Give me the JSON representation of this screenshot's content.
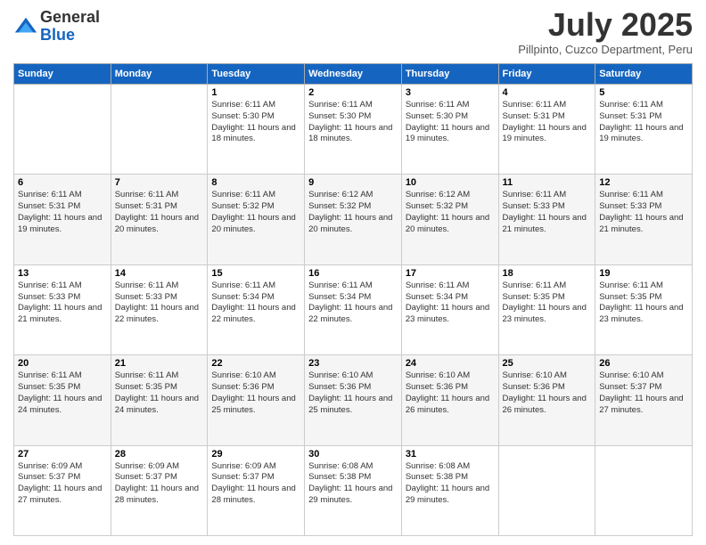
{
  "logo": {
    "general": "General",
    "blue": "Blue"
  },
  "header": {
    "month": "July 2025",
    "location": "Pillpinto, Cuzco Department, Peru"
  },
  "weekdays": [
    "Sunday",
    "Monday",
    "Tuesday",
    "Wednesday",
    "Thursday",
    "Friday",
    "Saturday"
  ],
  "weeks": [
    [
      {
        "day": "",
        "sunrise": "",
        "sunset": "",
        "daylight": ""
      },
      {
        "day": "",
        "sunrise": "",
        "sunset": "",
        "daylight": ""
      },
      {
        "day": "1",
        "sunrise": "Sunrise: 6:11 AM",
        "sunset": "Sunset: 5:30 PM",
        "daylight": "Daylight: 11 hours and 18 minutes."
      },
      {
        "day": "2",
        "sunrise": "Sunrise: 6:11 AM",
        "sunset": "Sunset: 5:30 PM",
        "daylight": "Daylight: 11 hours and 18 minutes."
      },
      {
        "day": "3",
        "sunrise": "Sunrise: 6:11 AM",
        "sunset": "Sunset: 5:30 PM",
        "daylight": "Daylight: 11 hours and 19 minutes."
      },
      {
        "day": "4",
        "sunrise": "Sunrise: 6:11 AM",
        "sunset": "Sunset: 5:31 PM",
        "daylight": "Daylight: 11 hours and 19 minutes."
      },
      {
        "day": "5",
        "sunrise": "Sunrise: 6:11 AM",
        "sunset": "Sunset: 5:31 PM",
        "daylight": "Daylight: 11 hours and 19 minutes."
      }
    ],
    [
      {
        "day": "6",
        "sunrise": "Sunrise: 6:11 AM",
        "sunset": "Sunset: 5:31 PM",
        "daylight": "Daylight: 11 hours and 19 minutes."
      },
      {
        "day": "7",
        "sunrise": "Sunrise: 6:11 AM",
        "sunset": "Sunset: 5:31 PM",
        "daylight": "Daylight: 11 hours and 20 minutes."
      },
      {
        "day": "8",
        "sunrise": "Sunrise: 6:11 AM",
        "sunset": "Sunset: 5:32 PM",
        "daylight": "Daylight: 11 hours and 20 minutes."
      },
      {
        "day": "9",
        "sunrise": "Sunrise: 6:12 AM",
        "sunset": "Sunset: 5:32 PM",
        "daylight": "Daylight: 11 hours and 20 minutes."
      },
      {
        "day": "10",
        "sunrise": "Sunrise: 6:12 AM",
        "sunset": "Sunset: 5:32 PM",
        "daylight": "Daylight: 11 hours and 20 minutes."
      },
      {
        "day": "11",
        "sunrise": "Sunrise: 6:11 AM",
        "sunset": "Sunset: 5:33 PM",
        "daylight": "Daylight: 11 hours and 21 minutes."
      },
      {
        "day": "12",
        "sunrise": "Sunrise: 6:11 AM",
        "sunset": "Sunset: 5:33 PM",
        "daylight": "Daylight: 11 hours and 21 minutes."
      }
    ],
    [
      {
        "day": "13",
        "sunrise": "Sunrise: 6:11 AM",
        "sunset": "Sunset: 5:33 PM",
        "daylight": "Daylight: 11 hours and 21 minutes."
      },
      {
        "day": "14",
        "sunrise": "Sunrise: 6:11 AM",
        "sunset": "Sunset: 5:33 PM",
        "daylight": "Daylight: 11 hours and 22 minutes."
      },
      {
        "day": "15",
        "sunrise": "Sunrise: 6:11 AM",
        "sunset": "Sunset: 5:34 PM",
        "daylight": "Daylight: 11 hours and 22 minutes."
      },
      {
        "day": "16",
        "sunrise": "Sunrise: 6:11 AM",
        "sunset": "Sunset: 5:34 PM",
        "daylight": "Daylight: 11 hours and 22 minutes."
      },
      {
        "day": "17",
        "sunrise": "Sunrise: 6:11 AM",
        "sunset": "Sunset: 5:34 PM",
        "daylight": "Daylight: 11 hours and 23 minutes."
      },
      {
        "day": "18",
        "sunrise": "Sunrise: 6:11 AM",
        "sunset": "Sunset: 5:35 PM",
        "daylight": "Daylight: 11 hours and 23 minutes."
      },
      {
        "day": "19",
        "sunrise": "Sunrise: 6:11 AM",
        "sunset": "Sunset: 5:35 PM",
        "daylight": "Daylight: 11 hours and 23 minutes."
      }
    ],
    [
      {
        "day": "20",
        "sunrise": "Sunrise: 6:11 AM",
        "sunset": "Sunset: 5:35 PM",
        "daylight": "Daylight: 11 hours and 24 minutes."
      },
      {
        "day": "21",
        "sunrise": "Sunrise: 6:11 AM",
        "sunset": "Sunset: 5:35 PM",
        "daylight": "Daylight: 11 hours and 24 minutes."
      },
      {
        "day": "22",
        "sunrise": "Sunrise: 6:10 AM",
        "sunset": "Sunset: 5:36 PM",
        "daylight": "Daylight: 11 hours and 25 minutes."
      },
      {
        "day": "23",
        "sunrise": "Sunrise: 6:10 AM",
        "sunset": "Sunset: 5:36 PM",
        "daylight": "Daylight: 11 hours and 25 minutes."
      },
      {
        "day": "24",
        "sunrise": "Sunrise: 6:10 AM",
        "sunset": "Sunset: 5:36 PM",
        "daylight": "Daylight: 11 hours and 26 minutes."
      },
      {
        "day": "25",
        "sunrise": "Sunrise: 6:10 AM",
        "sunset": "Sunset: 5:36 PM",
        "daylight": "Daylight: 11 hours and 26 minutes."
      },
      {
        "day": "26",
        "sunrise": "Sunrise: 6:10 AM",
        "sunset": "Sunset: 5:37 PM",
        "daylight": "Daylight: 11 hours and 27 minutes."
      }
    ],
    [
      {
        "day": "27",
        "sunrise": "Sunrise: 6:09 AM",
        "sunset": "Sunset: 5:37 PM",
        "daylight": "Daylight: 11 hours and 27 minutes."
      },
      {
        "day": "28",
        "sunrise": "Sunrise: 6:09 AM",
        "sunset": "Sunset: 5:37 PM",
        "daylight": "Daylight: 11 hours and 28 minutes."
      },
      {
        "day": "29",
        "sunrise": "Sunrise: 6:09 AM",
        "sunset": "Sunset: 5:37 PM",
        "daylight": "Daylight: 11 hours and 28 minutes."
      },
      {
        "day": "30",
        "sunrise": "Sunrise: 6:08 AM",
        "sunset": "Sunset: 5:38 PM",
        "daylight": "Daylight: 11 hours and 29 minutes."
      },
      {
        "day": "31",
        "sunrise": "Sunrise: 6:08 AM",
        "sunset": "Sunset: 5:38 PM",
        "daylight": "Daylight: 11 hours and 29 minutes."
      },
      {
        "day": "",
        "sunrise": "",
        "sunset": "",
        "daylight": ""
      },
      {
        "day": "",
        "sunrise": "",
        "sunset": "",
        "daylight": ""
      }
    ]
  ]
}
